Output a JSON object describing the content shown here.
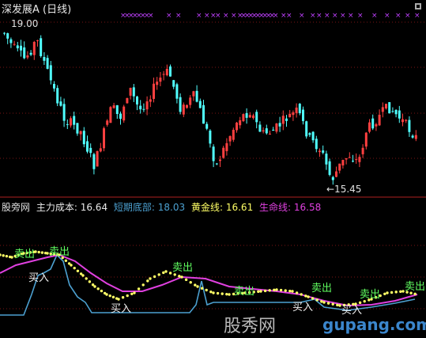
{
  "header": {
    "stock": "深发展A",
    "period": "(日线)"
  },
  "price_labels": {
    "high": "19.00",
    "low": "←15.45"
  },
  "indicator": {
    "name": "股旁网",
    "main_cost_label": "主力成本:",
    "main_cost_value": "16.64",
    "short_bottom_label": "短期底部:",
    "short_bottom_value": "18.03",
    "gold_label": "黄金线:",
    "gold_value": "16.61",
    "life_label": "生命线:",
    "life_value": "16.58"
  },
  "signals": {
    "sell": "卖出",
    "buy": "买入"
  },
  "watermark": {
    "site_cn": "股秀网",
    "site_url": "gupang.com"
  },
  "colors": {
    "up": "#ff4040",
    "down": "#50ffff",
    "sell_marker": "#c040ff",
    "main_cost": "#ffff80",
    "short_bottom": "#4ca0d0",
    "gold": "#ffff66",
    "life": "#e040e0",
    "signal_green": "#60ff60"
  }
}
